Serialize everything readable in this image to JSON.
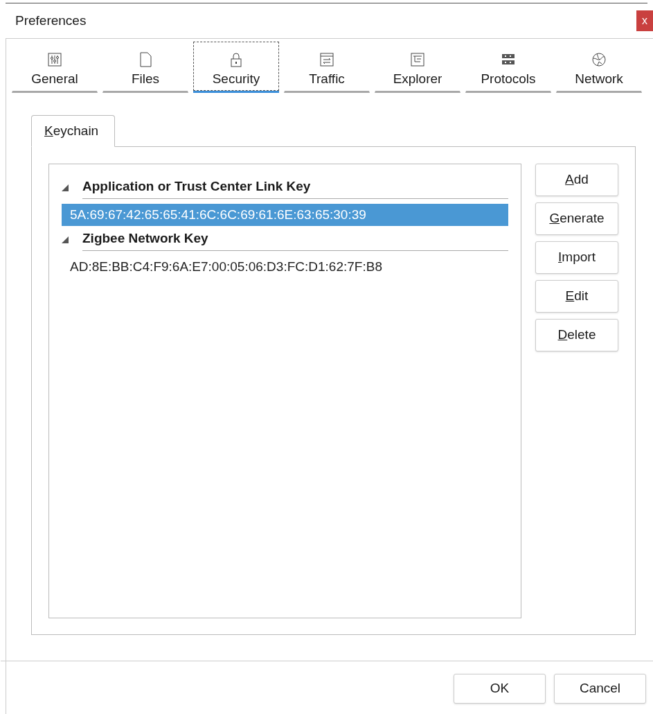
{
  "window": {
    "title": "Preferences",
    "close": "x"
  },
  "tabs": [
    {
      "label": "General",
      "selected": false
    },
    {
      "label": "Files",
      "selected": false
    },
    {
      "label": "Security",
      "selected": true
    },
    {
      "label": "Traffic",
      "selected": false
    },
    {
      "label": "Explorer",
      "selected": false
    },
    {
      "label": "Protocols",
      "selected": false
    },
    {
      "label": "Network",
      "selected": false
    }
  ],
  "subtabs": [
    {
      "label": "Keychain",
      "selected": true
    }
  ],
  "tree": [
    {
      "label": "Application or Trust Center Link Key",
      "expanded": true,
      "children": [
        {
          "label": "5A:69:67:42:65:65:41:6C:6C:69:61:6E:63:65:30:39",
          "selected": true
        }
      ]
    },
    {
      "label": "Zigbee Network Key",
      "expanded": true,
      "children": [
        {
          "label": "AD:8E:BB:C4:F9:6A:E7:00:05:06:D3:FC:D1:62:7F:B8",
          "selected": false
        }
      ]
    }
  ],
  "side_buttons": [
    "Add",
    "Generate",
    "Import",
    "Edit",
    "Delete"
  ],
  "footer_buttons": [
    "OK",
    "Cancel"
  ]
}
